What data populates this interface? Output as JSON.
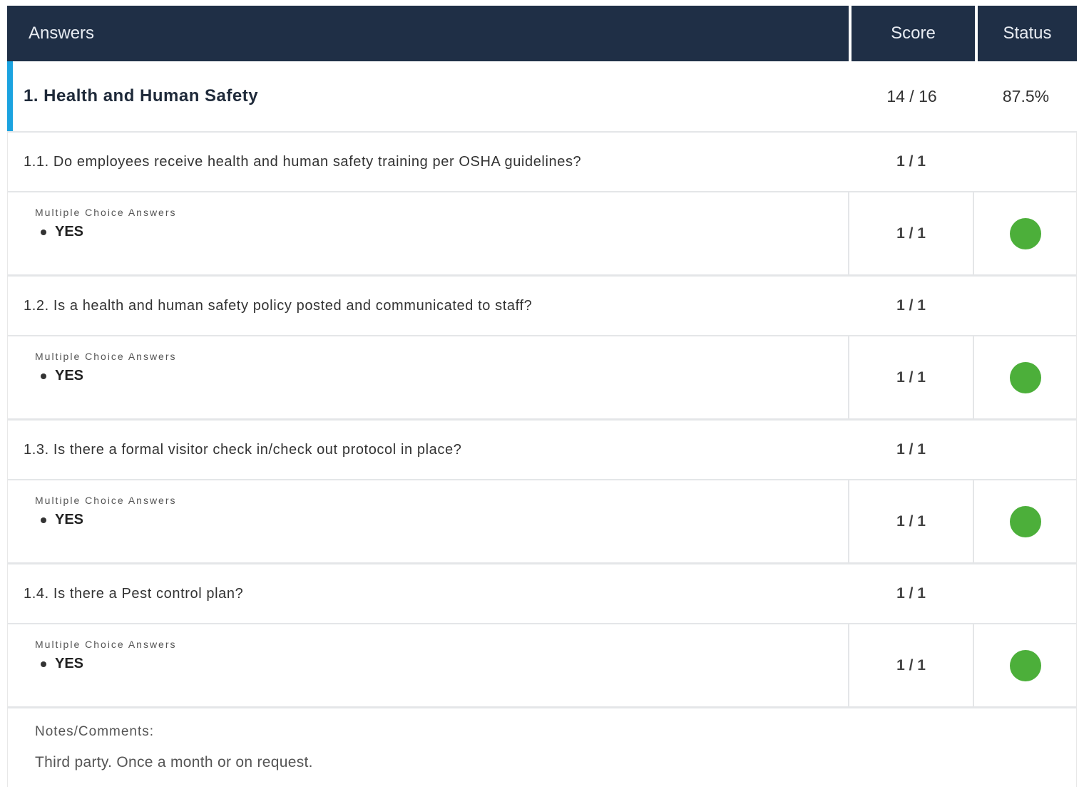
{
  "header": {
    "answers_label": "Answers",
    "score_label": "Score",
    "status_label": "Status"
  },
  "section": {
    "title": "1. Health and Human Safety",
    "score": "14 / 16",
    "percent": "87.5%",
    "accent_color": "#1ba3e0"
  },
  "status_color": "#4caf3a",
  "questions": [
    {
      "text": "1.1. Do employees receive health and human safety training per OSHA guidelines?",
      "score": "1 / 1",
      "answer_label": "Multiple Choice Answers",
      "answer": "YES",
      "answer_score": "1 / 1"
    },
    {
      "text": "1.2. Is a health and human safety policy posted and communicated to staff?",
      "score": "1 / 1",
      "answer_label": "Multiple Choice Answers",
      "answer": "YES",
      "answer_score": "1 / 1"
    },
    {
      "text": "1.3. Is there a formal visitor check in/check out protocol in place?",
      "score": "1 / 1",
      "answer_label": "Multiple Choice Answers",
      "answer": "YES",
      "answer_score": "1 / 1"
    },
    {
      "text": "1.4. Is there a Pest control plan?",
      "score": "1 / 1",
      "answer_label": "Multiple Choice Answers",
      "answer": "YES",
      "answer_score": "1 / 1"
    }
  ],
  "notes": {
    "label": "Notes/Comments:",
    "text": "Third party. Once a month or on request."
  }
}
